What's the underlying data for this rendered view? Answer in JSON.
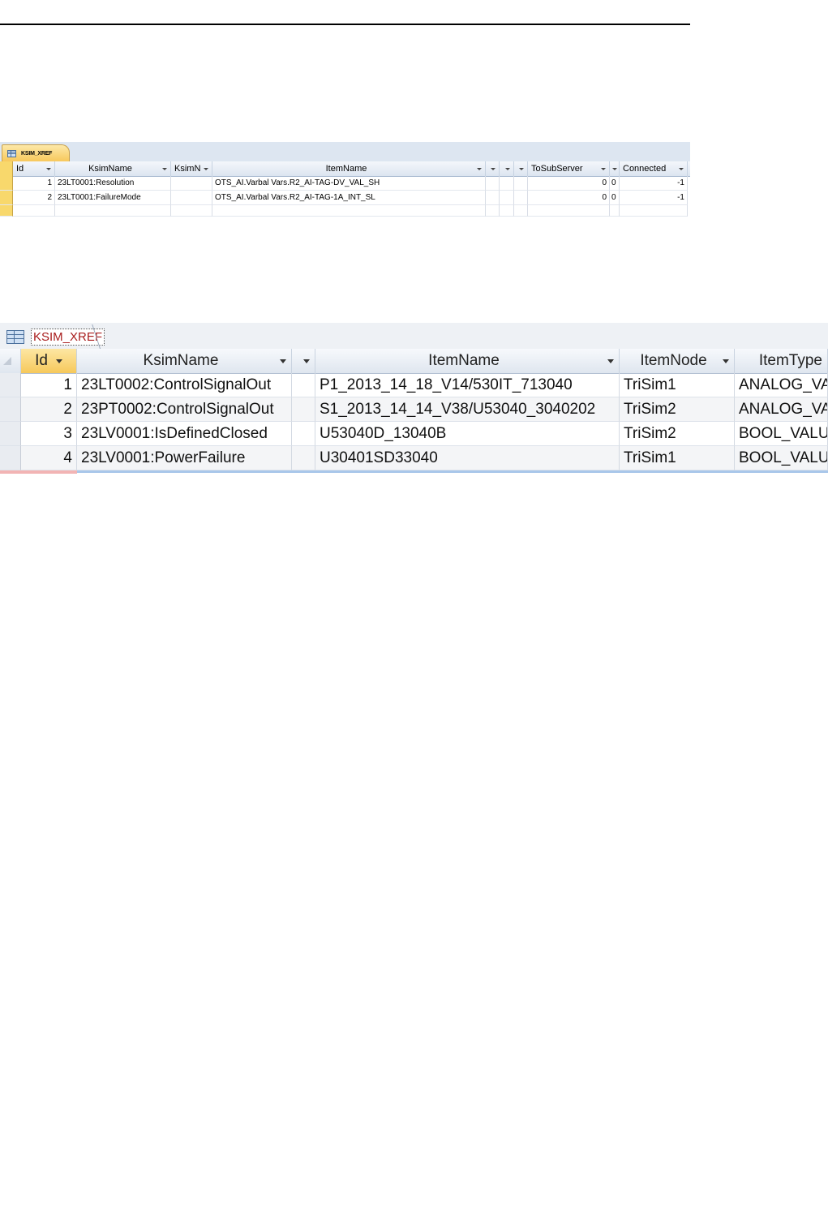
{
  "small_table": {
    "tab_label": "KSIM_XREF",
    "columns": [
      {
        "label": "Id"
      },
      {
        "label": "KsimName"
      },
      {
        "label": "KsimN"
      },
      {
        "label": "ItemName"
      },
      {
        "label": ""
      },
      {
        "label": ""
      },
      {
        "label": ""
      },
      {
        "label": "ToSubServer"
      },
      {
        "label": ""
      },
      {
        "label": "Connected"
      }
    ],
    "rows": [
      {
        "id": "1",
        "ksim_name": "23LT0001:Resolution",
        "ksim_n": "",
        "item_name": "OTS_AI.Varbal Vars.R2_AI-TAG-DV_VAL_SH",
        "c5": "",
        "c6": "",
        "c7": "",
        "to_sub_server": "0",
        "c9": "0",
        "connected": "-1"
      },
      {
        "id": "2",
        "ksim_name": "23LT0001:FailureMode",
        "ksim_n": "",
        "item_name": "OTS_AI.Varbal Vars.R2_AI-TAG-1A_INT_SL",
        "c5": "",
        "c6": "",
        "c7": "",
        "to_sub_server": "0",
        "c9": "0",
        "connected": "-1"
      }
    ]
  },
  "large_table": {
    "tab_label": "KSIM_XREF",
    "columns": [
      {
        "label": "Id"
      },
      {
        "label": "KsimName"
      },
      {
        "label": ""
      },
      {
        "label": "ItemName"
      },
      {
        "label": "ItemNode"
      },
      {
        "label": "ItemType"
      }
    ],
    "rows": [
      {
        "id": "1",
        "ksim_name": "23LT0002:ControlSignalOut",
        "blank": "",
        "item_name": "P1_2013_14_18_V14/530IT_713040",
        "item_node": "TriSim1",
        "item_type": "ANALOG_VA"
      },
      {
        "id": "2",
        "ksim_name": "23PT0002:ControlSignalOut",
        "blank": "",
        "item_name": "S1_2013_14_14_V38/U53040_3040202",
        "item_node": "TriSim2",
        "item_type": "ANALOG_VA"
      },
      {
        "id": "3",
        "ksim_name": "23LV0001:IsDefinedClosed",
        "blank": "",
        "item_name": "U53040D_13040B",
        "item_node": "TriSim2",
        "item_type": "BOOL_VALU"
      },
      {
        "id": "4",
        "ksim_name": "23LV0001:PowerFailure",
        "blank": "",
        "item_name": "U30401SD33040",
        "item_node": "TriSim1",
        "item_type": "BOOL_VALU"
      }
    ]
  },
  "colors": {
    "tab_active": "#f7c85c",
    "header_bg": "#dfe6ef",
    "tab_label_red": "#a81c1c",
    "selection_yellow": "#f8d86c"
  }
}
